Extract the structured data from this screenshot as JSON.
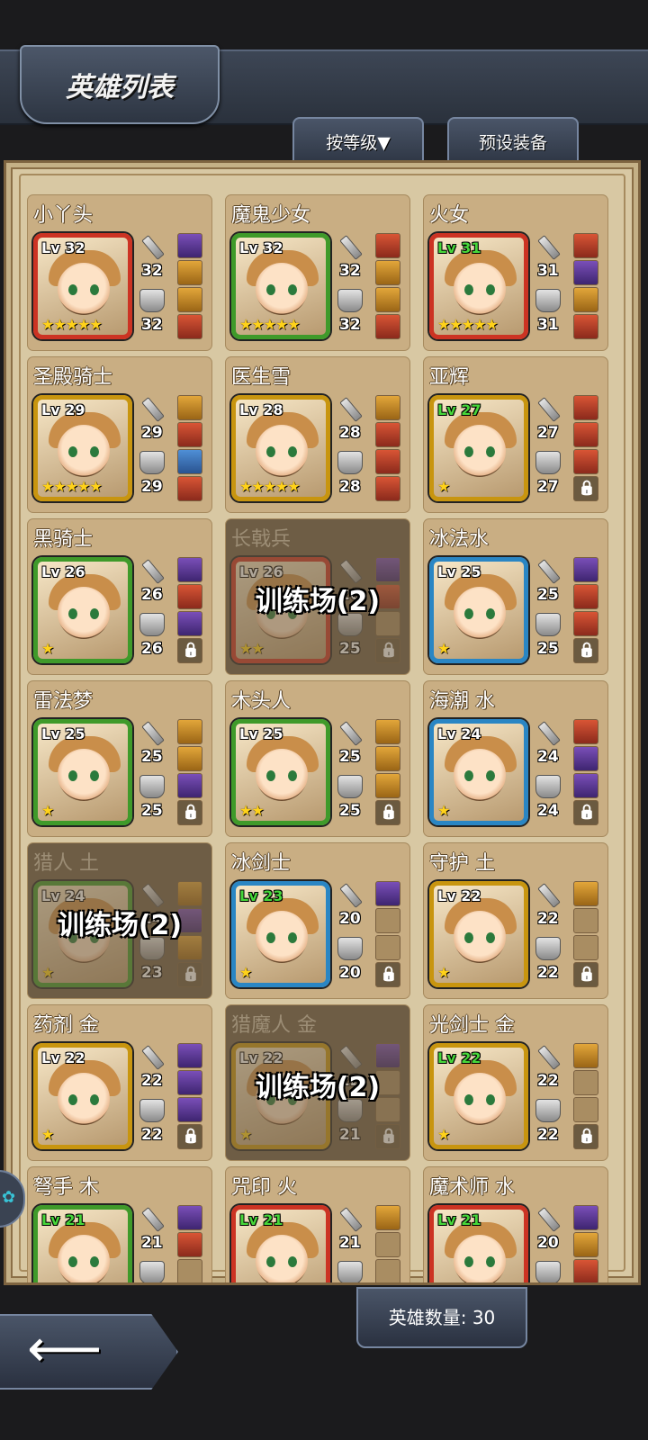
{
  "header": {
    "title": "英雄列表",
    "sort_label": "按等级▼",
    "preset_label": "预设装备"
  },
  "footer": {
    "hero_count_label": "英雄数量: 30"
  },
  "heroes": [
    {
      "name": "小丫头",
      "level": "Lv 32",
      "stars": "★★★★★",
      "weapon": "32",
      "armor": "32",
      "frame": "red",
      "lv_color": "white",
      "slots": [
        "purple",
        "gold",
        "gold",
        "red"
      ],
      "dim": false,
      "overlay": ""
    },
    {
      "name": "魔鬼少女",
      "level": "Lv 32",
      "stars": "★★★★★",
      "weapon": "32",
      "armor": "32",
      "frame": "green",
      "lv_color": "white",
      "slots": [
        "red",
        "gold",
        "gold",
        "red"
      ],
      "dim": false,
      "overlay": ""
    },
    {
      "name": "火女",
      "level": "Lv 31",
      "stars": "★★★★★",
      "weapon": "31",
      "armor": "31",
      "frame": "red",
      "lv_color": "green",
      "slots": [
        "red",
        "purple",
        "gold",
        "red"
      ],
      "dim": false,
      "overlay": ""
    },
    {
      "name": "圣殿骑士",
      "level": "Lv 29",
      "stars": "★★★★★",
      "weapon": "29",
      "armor": "29",
      "frame": "gold",
      "lv_color": "white",
      "slots": [
        "gold",
        "red",
        "blue",
        "red"
      ],
      "dim": false,
      "overlay": ""
    },
    {
      "name": "医生雪",
      "level": "Lv 28",
      "stars": "★★★★★",
      "weapon": "28",
      "armor": "28",
      "frame": "gold",
      "lv_color": "white",
      "slots": [
        "gold",
        "red",
        "red",
        "red"
      ],
      "dim": false,
      "overlay": ""
    },
    {
      "name": "亚辉",
      "level": "Lv 27",
      "stars": "★",
      "weapon": "27",
      "armor": "27",
      "frame": "gold",
      "lv_color": "green",
      "slots": [
        "red",
        "red",
        "red",
        "lock"
      ],
      "dim": false,
      "overlay": ""
    },
    {
      "name": "黑骑士",
      "level": "Lv 26",
      "stars": "★",
      "weapon": "26",
      "armor": "26",
      "frame": "green",
      "lv_color": "white",
      "slots": [
        "purple",
        "red",
        "purple",
        "lock"
      ],
      "dim": false,
      "overlay": ""
    },
    {
      "name": "长戟兵",
      "level": "Lv 26",
      "stars": "★★",
      "weapon": "26",
      "armor": "25",
      "frame": "red",
      "lv_color": "white",
      "slots": [
        "purple",
        "red",
        "empty",
        "lock"
      ],
      "dim": true,
      "overlay": "训练场(2)"
    },
    {
      "name": "冰法水",
      "level": "Lv 25",
      "stars": "★",
      "weapon": "25",
      "armor": "25",
      "frame": "blue",
      "lv_color": "white",
      "slots": [
        "purple",
        "red",
        "red",
        "lock"
      ],
      "dim": false,
      "overlay": ""
    },
    {
      "name": "雷法梦",
      "level": "Lv 25",
      "stars": "★",
      "weapon": "25",
      "armor": "25",
      "frame": "green",
      "lv_color": "white",
      "slots": [
        "gold",
        "gold",
        "purple",
        "lock"
      ],
      "dim": false,
      "overlay": ""
    },
    {
      "name": "木头人",
      "level": "Lv 25",
      "stars": "★★",
      "weapon": "25",
      "armor": "25",
      "frame": "green",
      "lv_color": "white",
      "slots": [
        "gold",
        "gold",
        "gold",
        "lock"
      ],
      "dim": false,
      "overlay": ""
    },
    {
      "name": "海潮 水",
      "level": "Lv 24",
      "stars": "★",
      "weapon": "24",
      "armor": "24",
      "frame": "blue",
      "lv_color": "white",
      "slots": [
        "red",
        "purple",
        "purple",
        "lock"
      ],
      "dim": false,
      "overlay": ""
    },
    {
      "name": "猎人 土",
      "level": "Lv 24",
      "stars": "★",
      "weapon": "24",
      "armor": "23",
      "frame": "green",
      "lv_color": "white",
      "slots": [
        "gold",
        "purple",
        "gold",
        "lock"
      ],
      "dim": true,
      "overlay": "训练场(2)"
    },
    {
      "name": "冰剑士",
      "level": "Lv 23",
      "stars": "★",
      "weapon": "20",
      "armor": "20",
      "frame": "blue",
      "lv_color": "green",
      "slots": [
        "purple",
        "empty",
        "empty",
        "lock"
      ],
      "dim": false,
      "overlay": ""
    },
    {
      "name": "守护 土",
      "level": "Lv 22",
      "stars": "★",
      "weapon": "22",
      "armor": "22",
      "frame": "gold",
      "lv_color": "white",
      "slots": [
        "gold",
        "empty",
        "empty",
        "lock"
      ],
      "dim": false,
      "overlay": ""
    },
    {
      "name": "药剂 金",
      "level": "Lv 22",
      "stars": "★",
      "weapon": "22",
      "armor": "22",
      "frame": "gold",
      "lv_color": "white",
      "slots": [
        "purple",
        "purple",
        "purple",
        "lock"
      ],
      "dim": false,
      "overlay": ""
    },
    {
      "name": "猎魔人 金",
      "level": "Lv 22",
      "stars": "★",
      "weapon": "22",
      "armor": "21",
      "frame": "gold",
      "lv_color": "white",
      "slots": [
        "purple",
        "empty",
        "empty",
        "lock"
      ],
      "dim": true,
      "overlay": "训练场(2)"
    },
    {
      "name": "光剑士 金",
      "level": "Lv 22",
      "stars": "★",
      "weapon": "22",
      "armor": "22",
      "frame": "gold",
      "lv_color": "green",
      "slots": [
        "gold",
        "empty",
        "empty",
        "lock"
      ],
      "dim": false,
      "overlay": ""
    },
    {
      "name": "弩手 木",
      "level": "Lv 21",
      "stars": "",
      "weapon": "21",
      "armor": "",
      "frame": "green",
      "lv_color": "green",
      "slots": [
        "purple",
        "red",
        "empty",
        "empty"
      ],
      "dim": false,
      "overlay": ""
    },
    {
      "name": "咒印 火",
      "level": "Lv 21",
      "stars": "",
      "weapon": "21",
      "armor": "",
      "frame": "red",
      "lv_color": "green",
      "slots": [
        "gold",
        "empty",
        "empty",
        "empty"
      ],
      "dim": false,
      "overlay": ""
    },
    {
      "name": "魔术师 水",
      "level": "Lv 21",
      "stars": "",
      "weapon": "20",
      "armor": "",
      "frame": "red",
      "lv_color": "green",
      "slots": [
        "purple",
        "gold",
        "red",
        "empty"
      ],
      "dim": false,
      "overlay": ""
    }
  ]
}
